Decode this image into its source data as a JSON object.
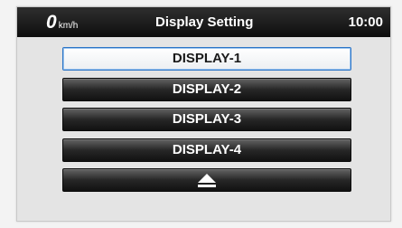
{
  "status_bar": {
    "speed_value": "0",
    "speed_unit": "km/h",
    "title": "Display Setting",
    "clock": "10:00"
  },
  "menu": {
    "items": [
      {
        "label": "DISPLAY-1",
        "selected": true
      },
      {
        "label": "DISPLAY-2",
        "selected": false
      },
      {
        "label": "DISPLAY-3",
        "selected": false
      },
      {
        "label": "DISPLAY-4",
        "selected": false
      }
    ],
    "eject_icon": "eject-icon"
  },
  "colors": {
    "selected_border": "#2b74c6",
    "button_dark": "#1c1c1c",
    "status_bar": "#111111"
  }
}
